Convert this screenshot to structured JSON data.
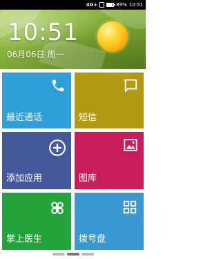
{
  "status_bar": {
    "network": "4G+",
    "battery": "89%",
    "battery_level": 0.89,
    "time": "10:51"
  },
  "clock_widget": {
    "time": "10:51",
    "date": "06月06日 周一",
    "weather_icon": "sun-icon"
  },
  "tiles": [
    {
      "label": "最近通话",
      "icon": "phone-icon",
      "color": "#2f9ed9"
    },
    {
      "label": "短信",
      "icon": "message-icon",
      "color": "#b29a12"
    },
    {
      "label": "添加应用",
      "icon": "add-circle-icon",
      "color": "#44589c"
    },
    {
      "label": "图库",
      "icon": "gallery-icon",
      "color": "#c81d5a"
    },
    {
      "label": "掌上医生",
      "icon": "clover-icon",
      "color": "#24a33a"
    },
    {
      "label": "拨号盘",
      "icon": "dialpad-icon",
      "color": "#3c98d3"
    }
  ],
  "page_indicator": {
    "pages": 3,
    "active": 1
  }
}
